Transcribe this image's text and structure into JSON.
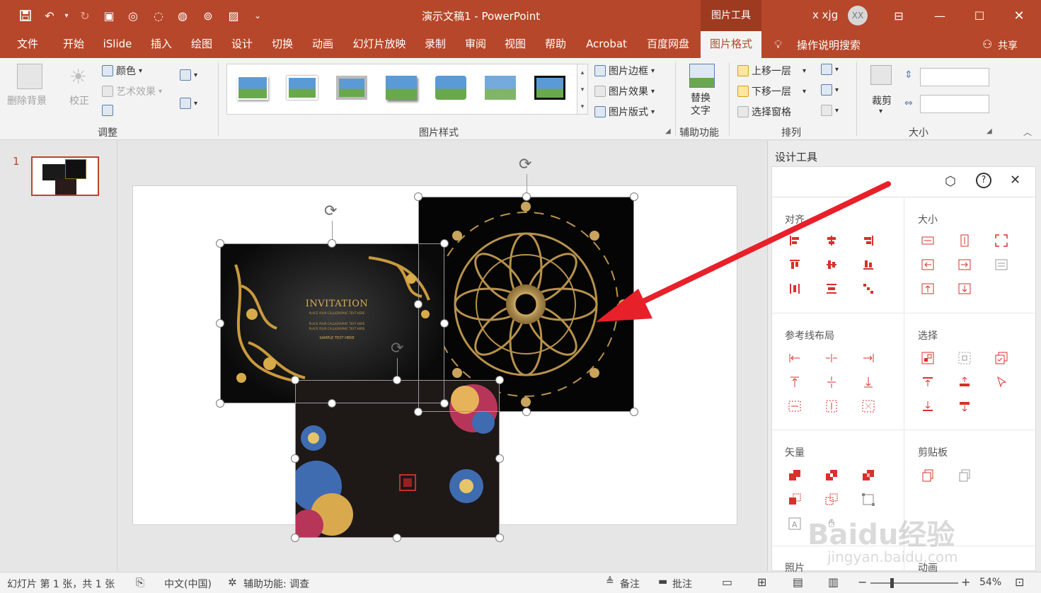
{
  "titlebar": {
    "document_title": "演示文稿1  -  PowerPoint",
    "context_tab": "图片工具",
    "user_name": "x xjg",
    "avatar_initials": "XX"
  },
  "tabs": [
    {
      "label": "文件"
    },
    {
      "label": "开始"
    },
    {
      "label": "iSlide"
    },
    {
      "label": "插入"
    },
    {
      "label": "绘图"
    },
    {
      "label": "设计"
    },
    {
      "label": "切换"
    },
    {
      "label": "动画"
    },
    {
      "label": "幻灯片放映"
    },
    {
      "label": "录制"
    },
    {
      "label": "审阅"
    },
    {
      "label": "视图"
    },
    {
      "label": "帮助"
    },
    {
      "label": "Acrobat"
    },
    {
      "label": "百度网盘"
    },
    {
      "label": "图片格式"
    }
  ],
  "search_hint": "操作说明搜索",
  "share_label": "共享",
  "ribbon": {
    "adjust": {
      "remove_bg": "删除背景",
      "corrections": "校正",
      "color": "颜色",
      "artistic": "艺术效果",
      "group": "调整"
    },
    "styles": {
      "border": "图片边框",
      "effects": "图片效果",
      "layout": "图片版式",
      "group": "图片样式"
    },
    "accessibility": {
      "alt_text_line1": "替换",
      "alt_text_line2": "文字",
      "group": "辅助功能"
    },
    "arrange": {
      "bring_forward": "上移一层",
      "send_backward": "下移一层",
      "selection_pane": "选择窗格",
      "group": "排列"
    },
    "size": {
      "crop": "裁剪",
      "group": "大小"
    }
  },
  "thumbnail_number": "1",
  "design_panel": {
    "title": "设计工具",
    "align": "对齐",
    "size": "大小",
    "guides": "参考线布局",
    "select": "选择",
    "vector": "矢量",
    "clipboard": "剪贴板",
    "photo": "照片",
    "anim": "动画"
  },
  "invitation": {
    "heading": "INVITATION",
    "line": "PLACE YOUR CALLIGRAPHIC TEXT HERE",
    "sample": "SAMPLE TEXT HERE"
  },
  "statusbar": {
    "slide_info": "幻灯片 第 1 张，共 1 张",
    "language": "中文(中国)",
    "accessibility": "辅助功能: 调查",
    "notes": "备注",
    "comments": "批注",
    "zoom": "54%"
  },
  "watermark": {
    "brand": "Baidu经验",
    "url": "jingyan.baidu.com"
  },
  "colors": {
    "brand": "#b7472a",
    "arrow": "#e8202a",
    "tool_icon": "#d9302c"
  }
}
